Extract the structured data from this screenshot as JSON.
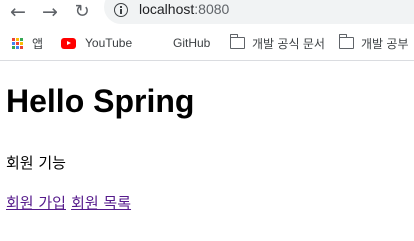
{
  "browser": {
    "back_icon": "arrow-left-icon",
    "forward_icon": "arrow-right-icon",
    "reload_icon": "reload-icon",
    "url_host": "localhost",
    "url_port": ":8080"
  },
  "bookmarks": [
    {
      "label": "앱",
      "icon": "apps-grid-icon"
    },
    {
      "label": "YouTube",
      "icon": "youtube-icon"
    },
    {
      "label": "GitHub",
      "icon": ""
    },
    {
      "label": "개발 공식 문서",
      "icon": "folder-icon"
    },
    {
      "label": "개발 공부",
      "icon": "folder-icon"
    }
  ],
  "page": {
    "title": "Hello Spring",
    "section_label": "회원 기능",
    "links": [
      {
        "label": "회원 가입"
      },
      {
        "label": "회원 목록"
      }
    ],
    "link_color": "#551a8b"
  }
}
